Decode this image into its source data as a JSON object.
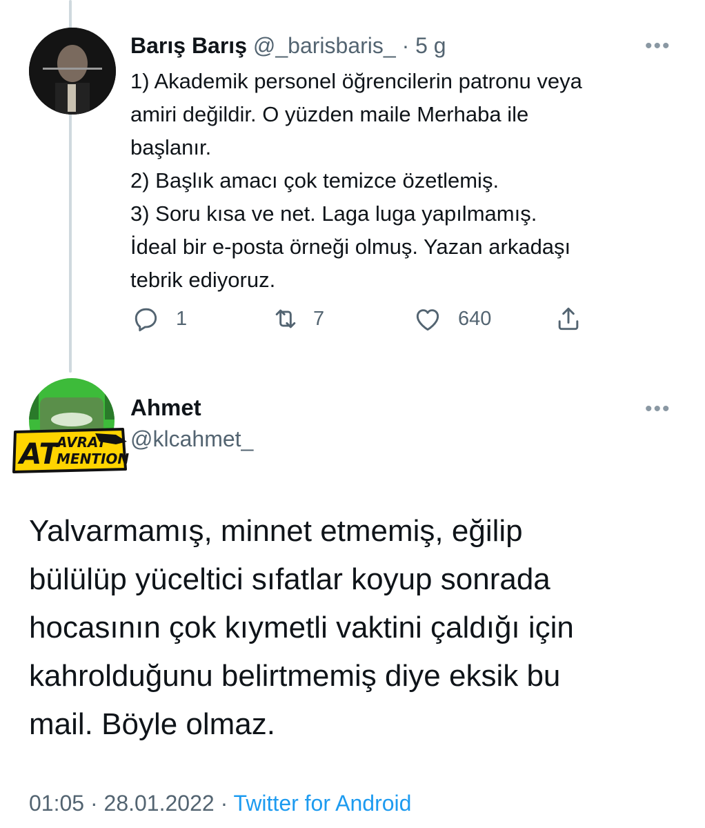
{
  "tweet1": {
    "display_name": "Barış Barış",
    "handle": "@_barisbaris_",
    "time": "· 5 g",
    "text": "1) Akademik personel öğrencilerin patronu veya\namiri değildir. O yüzden maile Merhaba ile\nbaşlanır.\n2) Başlık amacı çok temizce özetlemiş.\n3) Soru kısa ve net. Laga luga yapılmamış.\nİdeal bir e-posta örneği olmuş.  Yazan arkadaşı\ntebrik ediyoruz.",
    "more": "•••",
    "actions": {
      "replies": "1",
      "retweets": "7",
      "likes": "640"
    },
    "icons": [
      "reply-icon",
      "retweet-icon",
      "like-icon",
      "share-icon"
    ]
  },
  "tweet2": {
    "display_name": "Ahmet",
    "handle": "@klcahmet_",
    "more": "•••",
    "avatar_text": {
      "line_a": "AT",
      "line_b": "AVRAT",
      "line_c": "MENTION"
    },
    "text": "Yalvarmamış, minnet etmemiş, eğilip\nbülülüp yüceltici sıfatlar koyup sonrada\nhocasının çok kıymetli vaktini çaldığı için\nkahrolduğunu belirtmemiş diye eksik bu\nmail. Böyle olmaz.",
    "time": "01:05",
    "sep1": " · ",
    "date": "28.01.2022",
    "sep2": " · ",
    "source": "Twitter for Android"
  },
  "colors": {
    "text": "#0f1419",
    "secondary": "#536471",
    "link": "#1d9bf0",
    "thread_line": "#cfd9de",
    "avatar_green": "#3dbb3a",
    "avatar_yellow": "#ffd400"
  }
}
